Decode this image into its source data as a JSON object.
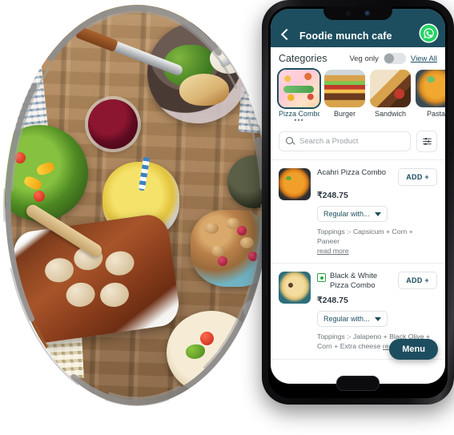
{
  "app": {
    "header": {
      "title": "Foodie munch cafe",
      "back_icon": "chevron-left-icon",
      "whatsapp_icon": "whatsapp-icon"
    },
    "categories_section": {
      "title": "Categories",
      "veg_only_label": "Veg only",
      "veg_only_enabled": false,
      "view_all_label": "View All",
      "overflow_dots": "•••",
      "items": [
        {
          "label": "Pizza Combo",
          "art": "t-pizzacombo",
          "active": true
        },
        {
          "label": "Burger",
          "art": "t-burger",
          "active": false
        },
        {
          "label": "Sandwich",
          "art": "t-sandwich",
          "active": false
        },
        {
          "label": "Pasta",
          "art": "t-pasta",
          "active": false
        }
      ]
    },
    "search": {
      "placeholder": "Search a Product",
      "value": "",
      "search_icon": "search-icon",
      "filter_icon": "filter-sliders-icon"
    },
    "products": [
      {
        "name": "Acahri Pizza Combo",
        "price": "₹248.75",
        "add_label": "ADD +",
        "variant_label": "Regular with...",
        "toppings": "Toppings :- Capsicum + Corn + Paneer",
        "read_more": "read more",
        "is_veg": false,
        "art": "pz-a"
      },
      {
        "name": "Black & White Pizza Combo",
        "price": "₹248.75",
        "add_label": "ADD +",
        "variant_label": "Regular with...",
        "toppings": "Toppings :- Jalapeno + Black Olive + Corn + Extra cheese",
        "read_more": "read more",
        "is_veg": true,
        "art": "pz-b"
      }
    ],
    "menu_fab_label": "Menu"
  },
  "photo": {
    "alt": "overhead-food-table-photo"
  },
  "colors": {
    "brand_teal": "#1d4e5f",
    "whatsapp_green": "#25d366",
    "veg_green": "#2aa745",
    "screen_bg": "#ffffff",
    "muted_text": "#6c757b"
  }
}
